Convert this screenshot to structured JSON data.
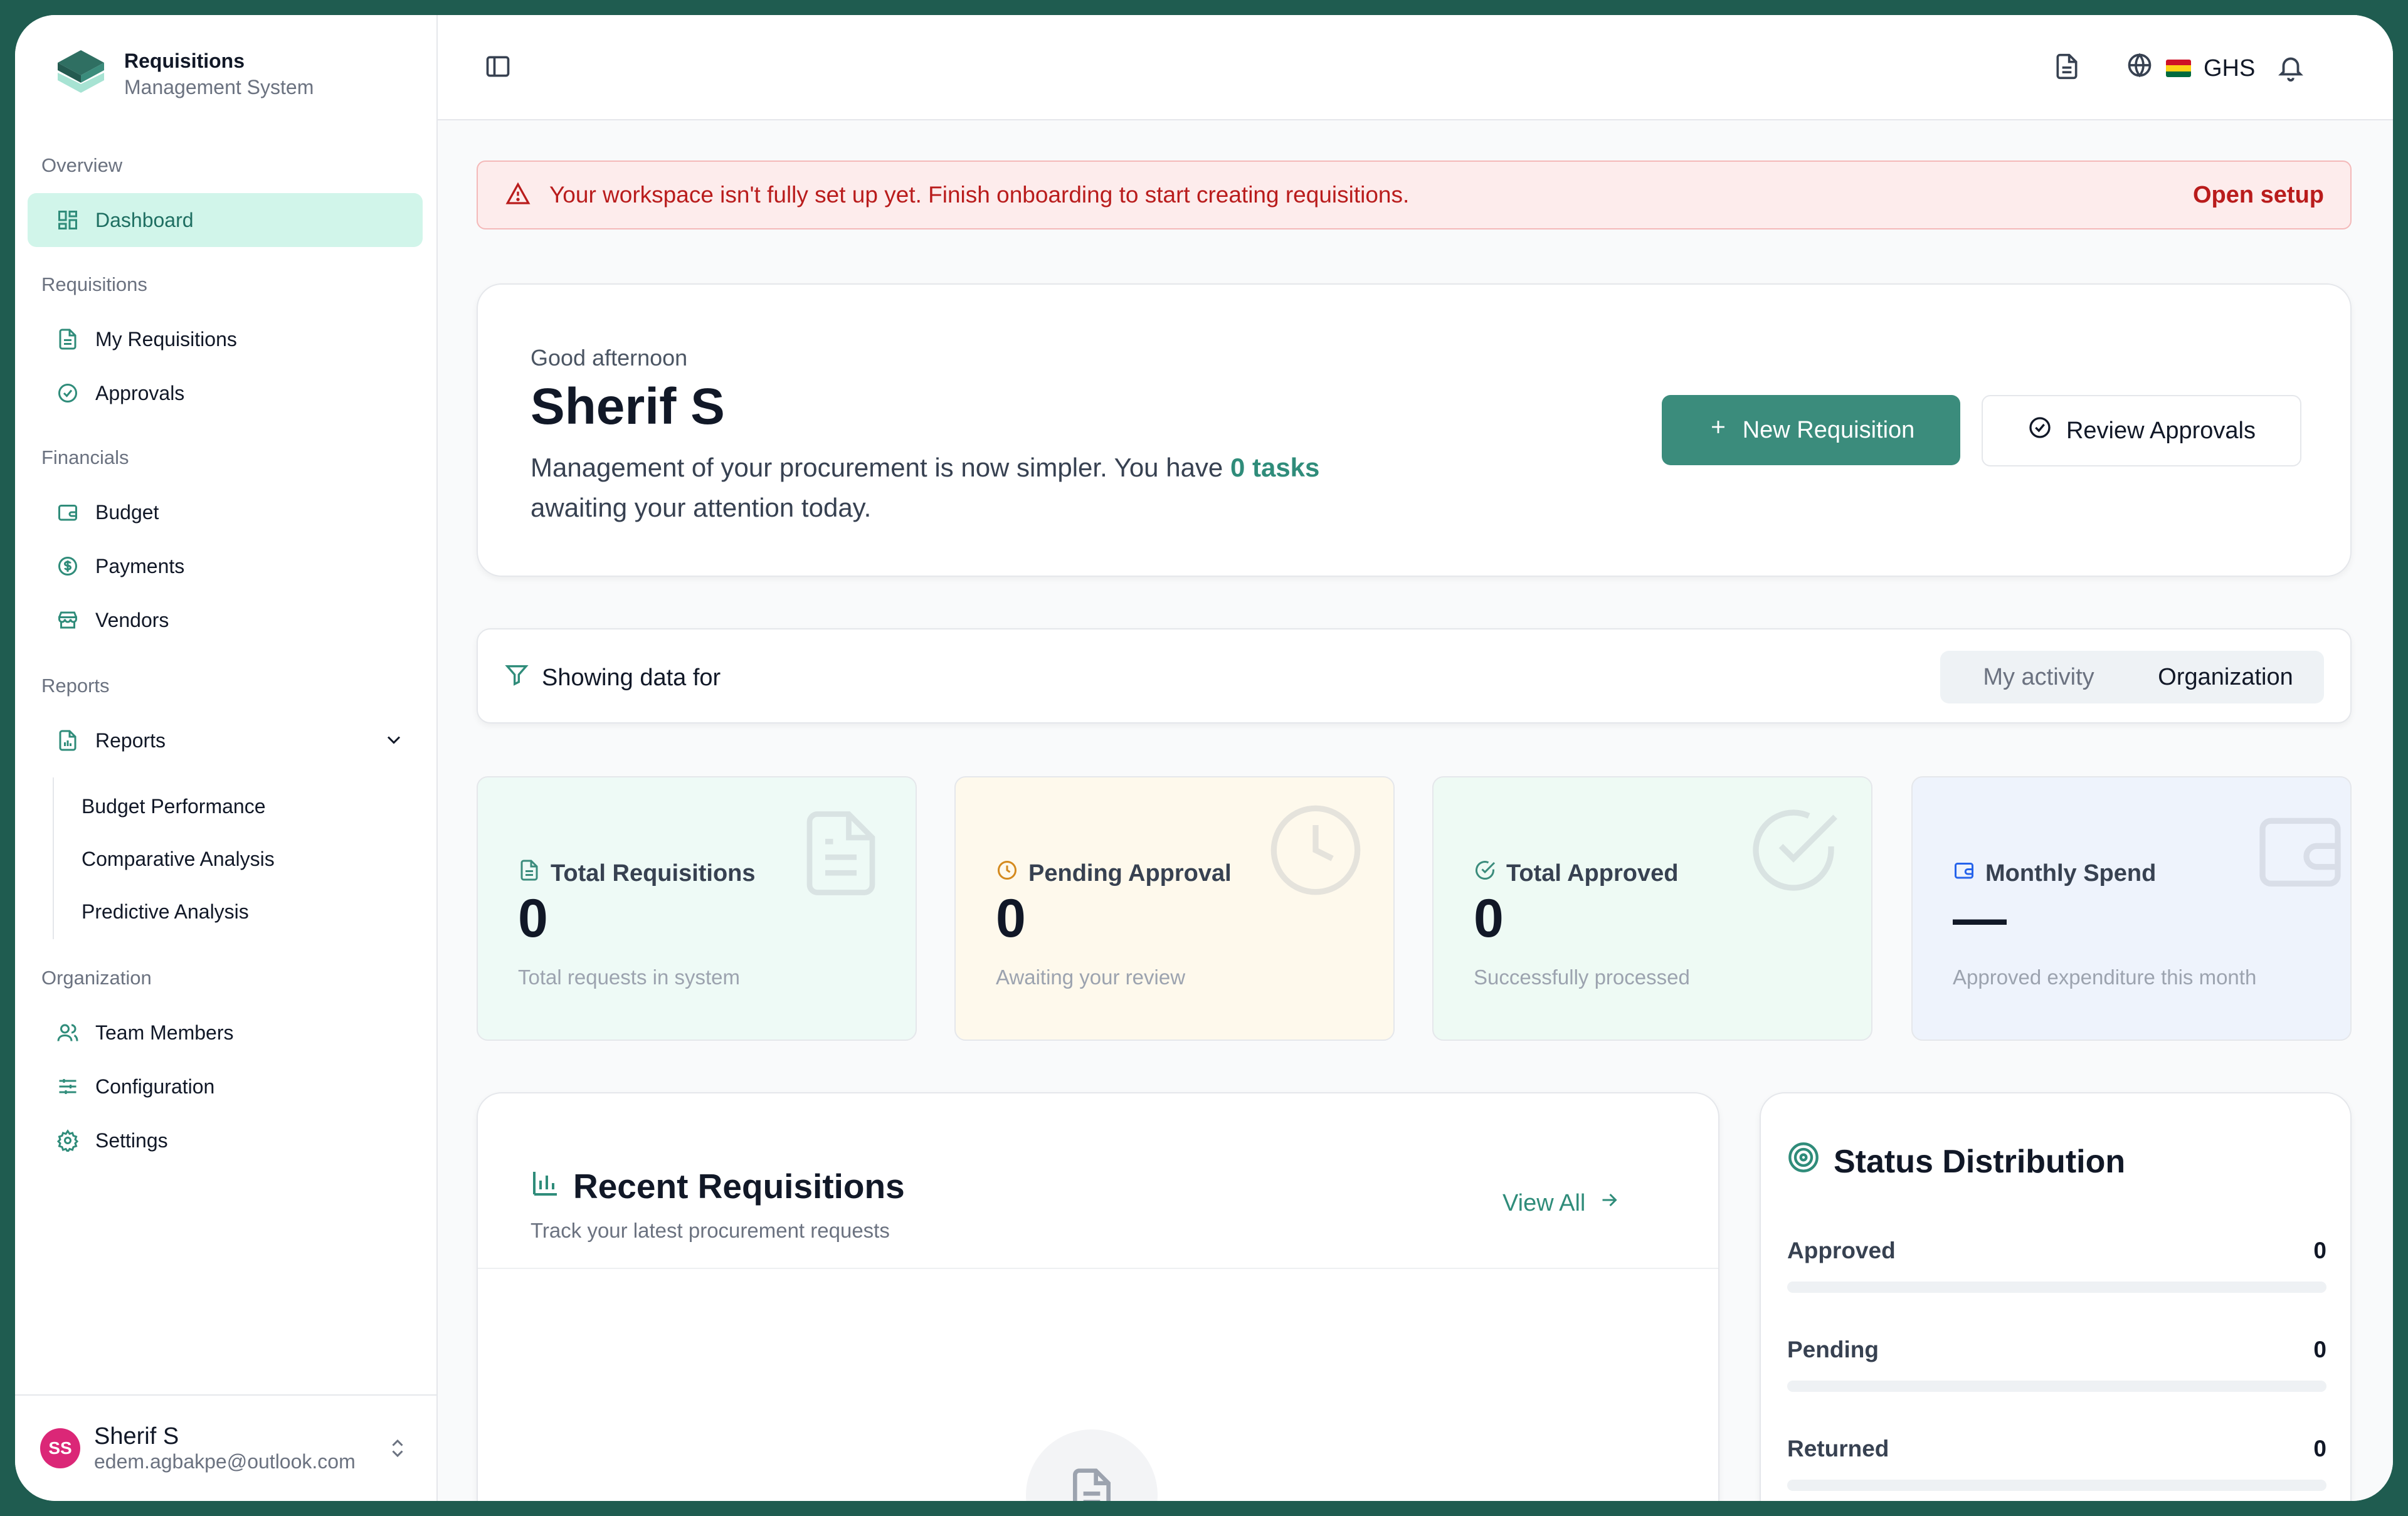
{
  "brand": {
    "title": "Requisitions",
    "subtitle": "Management System"
  },
  "sidebar": {
    "sections": {
      "overview": "Overview",
      "requisitions": "Requisitions",
      "financials": "Financials",
      "reports": "Reports",
      "organization": "Organization"
    },
    "items": {
      "dashboard": "Dashboard",
      "my_requisitions": "My Requisitions",
      "approvals": "Approvals",
      "budget": "Budget",
      "payments": "Payments",
      "vendors": "Vendors",
      "reports": "Reports",
      "team_members": "Team Members",
      "configuration": "Configuration",
      "settings": "Settings"
    },
    "report_subitems": [
      "Budget Performance",
      "Comparative Analysis",
      "Predictive Analysis"
    ],
    "user": {
      "initials": "SS",
      "name": "Sherif S",
      "email": "edem.agbakpe@outlook.com"
    }
  },
  "topbar": {
    "currency": "GHS"
  },
  "alert": {
    "message": "Your workspace isn't fully set up yet. Finish onboarding to start creating requisitions.",
    "action": "Open setup"
  },
  "hero": {
    "greeting": "Good afternoon",
    "name": "Sherif S",
    "message_pre": "Management of your procurement is now simpler. You have ",
    "tasks": "0 tasks",
    "message_post": " awaiting your attention today.",
    "new_button": "New Requisition",
    "review_button": "Review Approvals"
  },
  "filter": {
    "label": "Showing data for",
    "options": [
      "My activity",
      "Organization"
    ],
    "selected": "Organization"
  },
  "stats": [
    {
      "title": "Total Requisitions",
      "value": "0",
      "subtitle": "Total requests in system",
      "icon": "file-text-icon",
      "color": "#3b8c7c",
      "bg": "#eefaf6"
    },
    {
      "title": "Pending Approval",
      "value": "0",
      "subtitle": "Awaiting your review",
      "icon": "clock-icon",
      "color": "#d48a1e",
      "bg": "#fef9ec"
    },
    {
      "title": "Total Approved",
      "value": "0",
      "subtitle": "Successfully processed",
      "icon": "check-circle-icon",
      "color": "#3b8c7c",
      "bg": "#eefaf4"
    },
    {
      "title": "Monthly Spend",
      "value": "—",
      "subtitle": "Approved expenditure this month",
      "icon": "wallet-icon",
      "color": "#2563eb",
      "bg": "#eef3fc"
    }
  ],
  "recent": {
    "title": "Recent Requisitions",
    "subtitle": "Track your latest procurement requests",
    "view_all": "View All"
  },
  "status": {
    "title": "Status Distribution",
    "rows": [
      {
        "label": "Approved",
        "count": "0",
        "fraction": 0
      },
      {
        "label": "Pending",
        "count": "0",
        "fraction": 0
      },
      {
        "label": "Returned",
        "count": "0",
        "fraction": 0
      }
    ]
  }
}
